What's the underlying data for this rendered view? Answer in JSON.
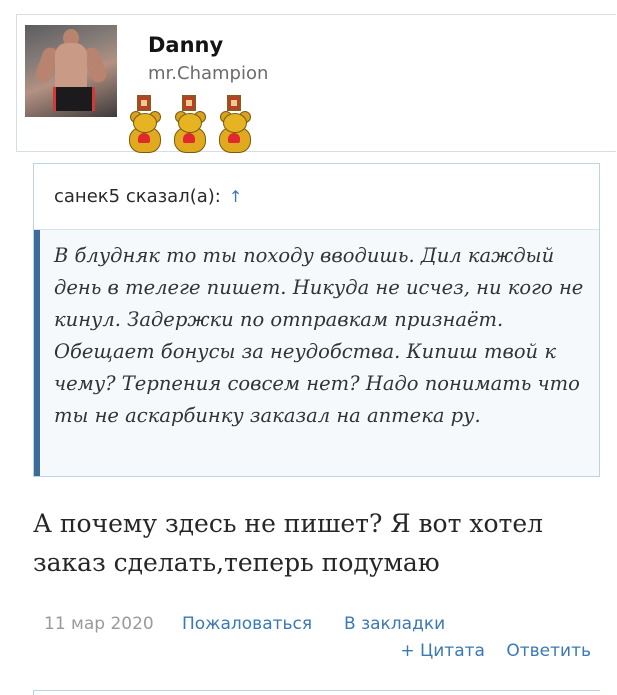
{
  "user": {
    "name": "Danny",
    "title": "mr.Champion",
    "awards": [
      "bear-medal-icon",
      "bear-medal-icon",
      "bear-medal-icon"
    ]
  },
  "quote": {
    "author_line": "санек5 сказал(а):",
    "jump_arrow": "↑",
    "text": "В блудняк то ты походу вводишь. Дил каждый день в телеге пишет. Никуда не исчез, ни кого не кинул. Задержки по отправкам признаёт. Обещает бонусы за неудобства. Кипиш твой к чему? Терпения совсем нет? Надо понимать что ты не аскарбинку заказал на аптека ру."
  },
  "post": {
    "text": "А почему здесь не пишет? Я вот хотел заказ сделать,теперь подумаю"
  },
  "meta": {
    "date": "11 мар 2020",
    "report": "Пожаловаться",
    "bookmark": "В закладки",
    "quote_action": "+ Цитата",
    "reply": "Ответить"
  },
  "colors": {
    "link": "#3b78b6",
    "quote_bar": "#3c6c9a",
    "border": "#bcd3e6"
  }
}
